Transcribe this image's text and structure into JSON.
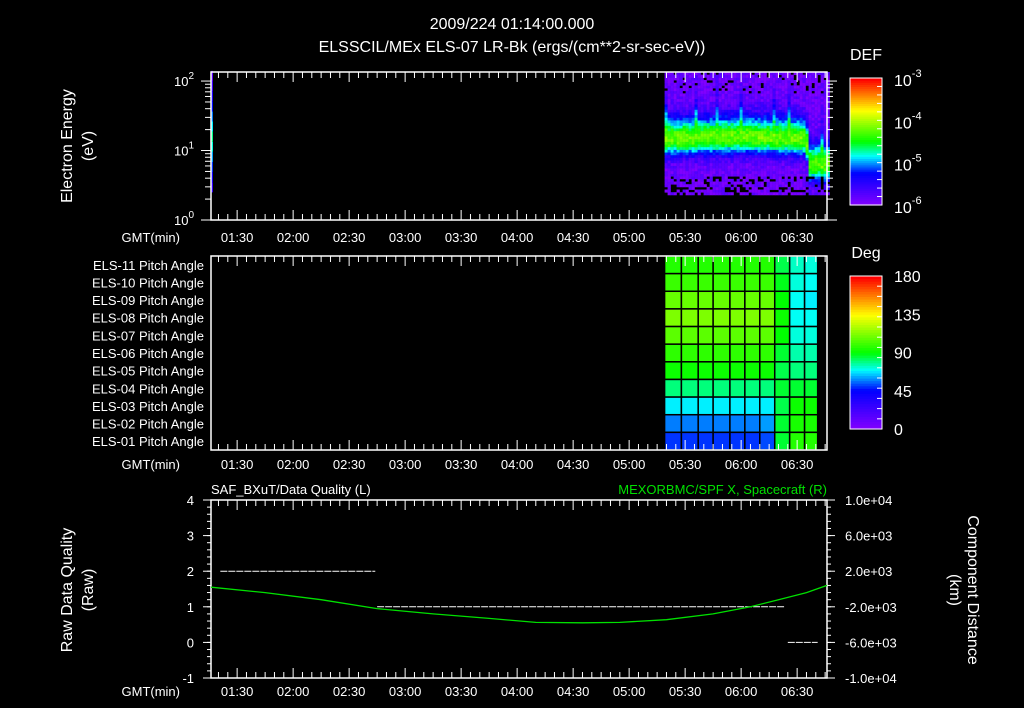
{
  "header": {
    "datetime": "2009/224 01:14:00.000",
    "title": "ELSSCIL/MEx ELS-07 LR-Bk  (ergs/(cm**2-sr-sec-eV))"
  },
  "colors": {
    "background": "#000000",
    "axis": "#ffffff",
    "orbit_line": "#00e000",
    "quality_line": "#ffffff"
  },
  "time_axis": {
    "label": "GMT(min)",
    "range": [
      "01:16",
      "06:46"
    ],
    "ticks": [
      "01:30",
      "02:00",
      "02:30",
      "03:00",
      "03:30",
      "04:00",
      "04:30",
      "05:00",
      "05:30",
      "06:00",
      "06:30"
    ]
  },
  "chart_data": [
    {
      "type": "heatmap",
      "name": "electron-energy-spectrogram",
      "ylabel": "Electron Energy",
      "yunit": "(eV)",
      "yscale": "log",
      "ylim": [
        1,
        135
      ],
      "yticks": [
        {
          "base": "10",
          "exp": "0",
          "value": 1
        },
        {
          "base": "10",
          "exp": "1",
          "value": 10
        },
        {
          "base": "10",
          "exp": "2",
          "value": 100
        }
      ],
      "colorbar": {
        "label": "DEF",
        "scale": "log",
        "range": [
          1e-06,
          0.001
        ],
        "ticks": [
          {
            "base": "10",
            "exp": "-3"
          },
          {
            "base": "10",
            "exp": "-4"
          },
          {
            "base": "10",
            "exp": "-5"
          },
          {
            "base": "10",
            "exp": "-6"
          }
        ]
      },
      "data_start": "05:19",
      "data_end": "06:46",
      "energy_range_eV": [
        2.3,
        135
      ],
      "peak_energy_eV": [
        {
          "time": "05:19",
          "energy": 14
        },
        {
          "time": "06:00",
          "energy": 15
        },
        {
          "time": "06:34",
          "energy": 14
        },
        {
          "time": "06:36",
          "energy": 6
        },
        {
          "time": "06:46",
          "energy": 6
        }
      ],
      "peak_log_def": -4.2,
      "background_log_def": -5.9,
      "initial_strip": {
        "time": "01:16",
        "energy_range_eV": [
          2.5,
          140
        ]
      }
    },
    {
      "type": "heatmap",
      "name": "pitch-angle",
      "colorbar": {
        "label": "Deg",
        "range": [
          0,
          180
        ],
        "ticks": [
          "180",
          "135",
          "90",
          "45",
          "0"
        ]
      },
      "rows": [
        "ELS-11 Pitch Angle",
        "ELS-10 Pitch Angle",
        "ELS-09 Pitch Angle",
        "ELS-08 Pitch Angle",
        "ELS-07 Pitch Angle",
        "ELS-06 Pitch Angle",
        "ELS-05 Pitch Angle",
        "ELS-04 Pitch Angle",
        "ELS-03 Pitch Angle",
        "ELS-02 Pitch Angle",
        "ELS-01 Pitch Angle"
      ],
      "column_times": [
        "05:19",
        "05:28",
        "05:37",
        "05:45",
        "05:54",
        "06:02",
        "06:10",
        "06:18",
        "06:26",
        "06:34"
      ],
      "data_end": "06:41",
      "values_deg": [
        [
          96,
          96,
          96,
          96,
          96,
          96,
          96,
          84,
          74,
          72
        ],
        [
          100,
          100,
          100,
          100,
          100,
          100,
          100,
          88,
          72,
          70
        ],
        [
          108,
          108,
          108,
          108,
          108,
          108,
          108,
          90,
          70,
          68
        ],
        [
          112,
          112,
          112,
          112,
          112,
          112,
          112,
          92,
          70,
          70
        ],
        [
          106,
          106,
          106,
          106,
          106,
          106,
          106,
          90,
          72,
          72
        ],
        [
          98,
          98,
          98,
          98,
          98,
          98,
          98,
          86,
          76,
          76
        ],
        [
          92,
          92,
          92,
          92,
          92,
          92,
          92,
          84,
          80,
          80
        ],
        [
          80,
          80,
          80,
          80,
          80,
          80,
          80,
          86,
          86,
          86
        ],
        [
          68,
          68,
          68,
          68,
          68,
          68,
          68,
          84,
          92,
          92
        ],
        [
          57,
          57,
          57,
          57,
          57,
          57,
          60,
          86,
          94,
          94
        ],
        [
          50,
          50,
          50,
          50,
          50,
          50,
          52,
          86,
          96,
          96
        ]
      ]
    },
    {
      "type": "line",
      "name": "data-quality-and-orbit",
      "left_title": "SAF_BXuT/Data Quality (L)",
      "right_title": "MEXORBMC/SPF X, Spacecraft (R)",
      "ylabel_left": "Raw Data Quality",
      "yunit_left": "(Raw)",
      "ylim_left": [
        -1,
        4
      ],
      "yticks_left": [
        "4",
        "3",
        "2",
        "1",
        "0",
        "-1"
      ],
      "ylabel_right": "Component Distance",
      "yunit_right": "(km)",
      "ylim_right": [
        -10000,
        10000
      ],
      "yticks_right": [
        "1.0e+04",
        "6.0e+03",
        "2.0e+03",
        "-2.0e+03",
        "-6.0e+03",
        "-1.0e+04"
      ],
      "data_quality_segments": [
        {
          "start": "01:21",
          "end": "02:44",
          "value": 2
        },
        {
          "start": "02:45",
          "end": "06:23",
          "value": 1
        },
        {
          "start": "06:25",
          "end": "06:41",
          "value": 0
        }
      ],
      "spacecraft_x_km": [
        {
          "time": "01:16",
          "value": 200
        },
        {
          "time": "01:45",
          "value": -400
        },
        {
          "time": "02:15",
          "value": -1200
        },
        {
          "time": "02:45",
          "value": -2200
        },
        {
          "time": "03:15",
          "value": -2800
        },
        {
          "time": "03:45",
          "value": -3300
        },
        {
          "time": "04:10",
          "value": -3750
        },
        {
          "time": "04:35",
          "value": -3800
        },
        {
          "time": "04:55",
          "value": -3750
        },
        {
          "time": "05:20",
          "value": -3450
        },
        {
          "time": "05:45",
          "value": -2800
        },
        {
          "time": "06:05",
          "value": -2000
        },
        {
          "time": "06:20",
          "value": -1200
        },
        {
          "time": "06:35",
          "value": -400
        },
        {
          "time": "06:46",
          "value": 400
        }
      ]
    }
  ]
}
